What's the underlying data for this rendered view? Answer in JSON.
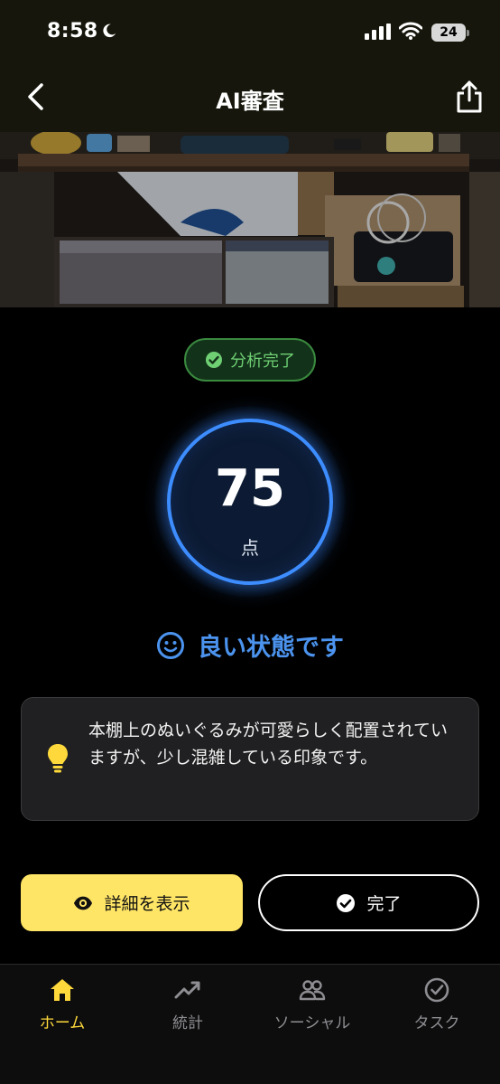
{
  "status_bar": {
    "time": "8:58",
    "battery": "24"
  },
  "nav": {
    "title": "AI審査"
  },
  "analysis": {
    "badge_label": "分析完了",
    "score": "75",
    "unit": "点",
    "status_text": "良い状態です"
  },
  "advice": {
    "text": "本棚上のぬいぐるみが可愛らしく配置されていますが、少し混雑している印象です。"
  },
  "actions": {
    "detail_label": "詳細を表示",
    "done_label": "完了"
  },
  "tabs": [
    {
      "label": "ホーム",
      "icon": "home-icon",
      "active": true
    },
    {
      "label": "統計",
      "icon": "trend-icon",
      "active": false
    },
    {
      "label": "ソーシャル",
      "icon": "people-icon",
      "active": false
    },
    {
      "label": "タスク",
      "icon": "check-circle-icon",
      "active": false
    }
  ],
  "colors": {
    "accent_yellow": "#ffe566",
    "accent_blue": "#3d8dff",
    "success_green": "#6fcf73"
  }
}
